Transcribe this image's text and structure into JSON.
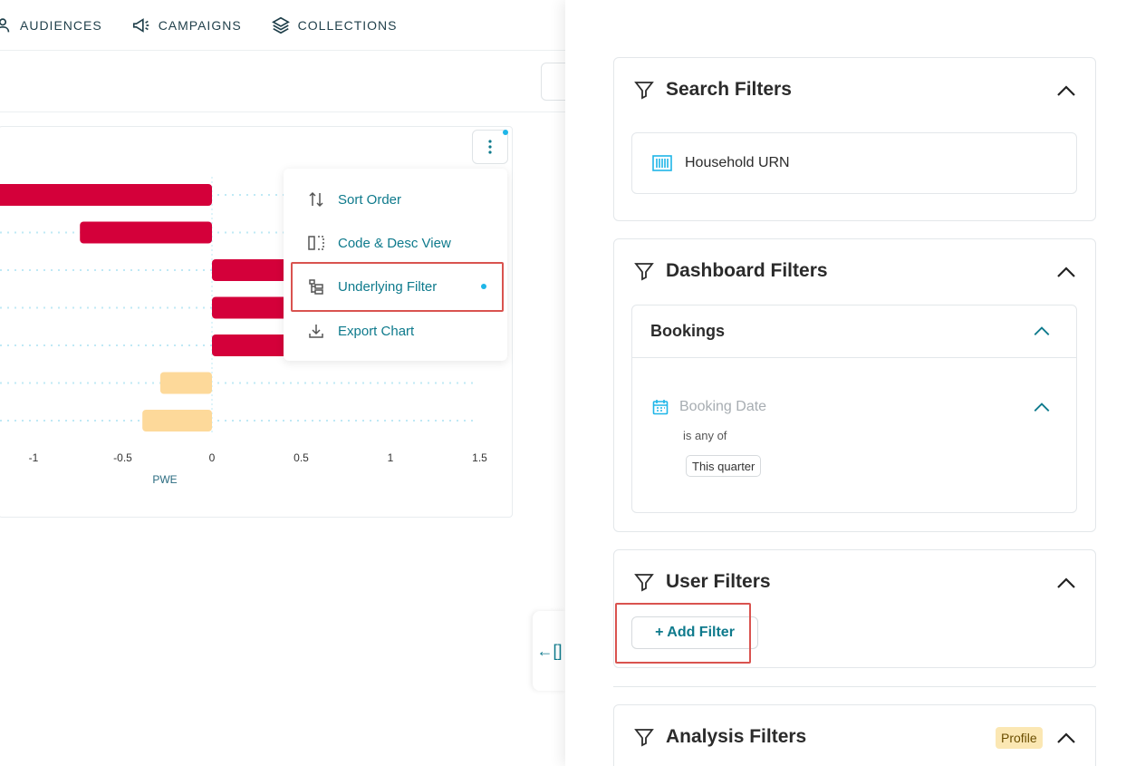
{
  "nav": {
    "items": [
      {
        "label": "AUDIENCES",
        "icon": "audiences-icon"
      },
      {
        "label": "CAMPAIGNS",
        "icon": "megaphone-icon"
      },
      {
        "label": "COLLECTIONS",
        "icon": "layers-icon"
      }
    ]
  },
  "chart_data": {
    "type": "bar",
    "orientation": "horizontal",
    "xlabel": "PWE",
    "xlim": [
      -1.2,
      1.5
    ],
    "xticks": [
      "-1",
      "-0.5",
      "0",
      "0.5",
      "1",
      "1.5"
    ],
    "values": [
      -1.3,
      -0.74,
      0.9,
      0.9,
      0.9,
      -0.29,
      -0.39
    ],
    "bar_colors": [
      "#d4003a",
      "#d4003a",
      "#d4003a",
      "#d4003a",
      "#d4003a",
      "#fdd99a",
      "#fdd99a"
    ]
  },
  "menu": {
    "items": [
      {
        "label": "Sort Order",
        "icon": "sort-icon"
      },
      {
        "label": "Code & Desc View",
        "icon": "split-view-icon"
      },
      {
        "label": "Underlying Filter",
        "icon": "filter-tree-icon"
      },
      {
        "label": "Export Chart",
        "icon": "download-icon"
      }
    ]
  },
  "panel": {
    "search_filters": {
      "title": "Search Filters",
      "item": "Household URN"
    },
    "dashboard_filters": {
      "title": "Dashboard Filters",
      "group": "Bookings",
      "field": "Booking Date",
      "operator": "is any of",
      "value": "This quarter"
    },
    "user_filters": {
      "title": "User Filters",
      "add_label": "+ Add Filter"
    },
    "analysis_filters": {
      "title": "Analysis Filters",
      "badge": "Profile"
    },
    "collapse_label": "←[]"
  },
  "colors": {
    "accent": "#0e7a8c",
    "negative_bar": "#d4003a",
    "neutral_bar": "#fdd99a",
    "highlight": "#d9534f"
  }
}
